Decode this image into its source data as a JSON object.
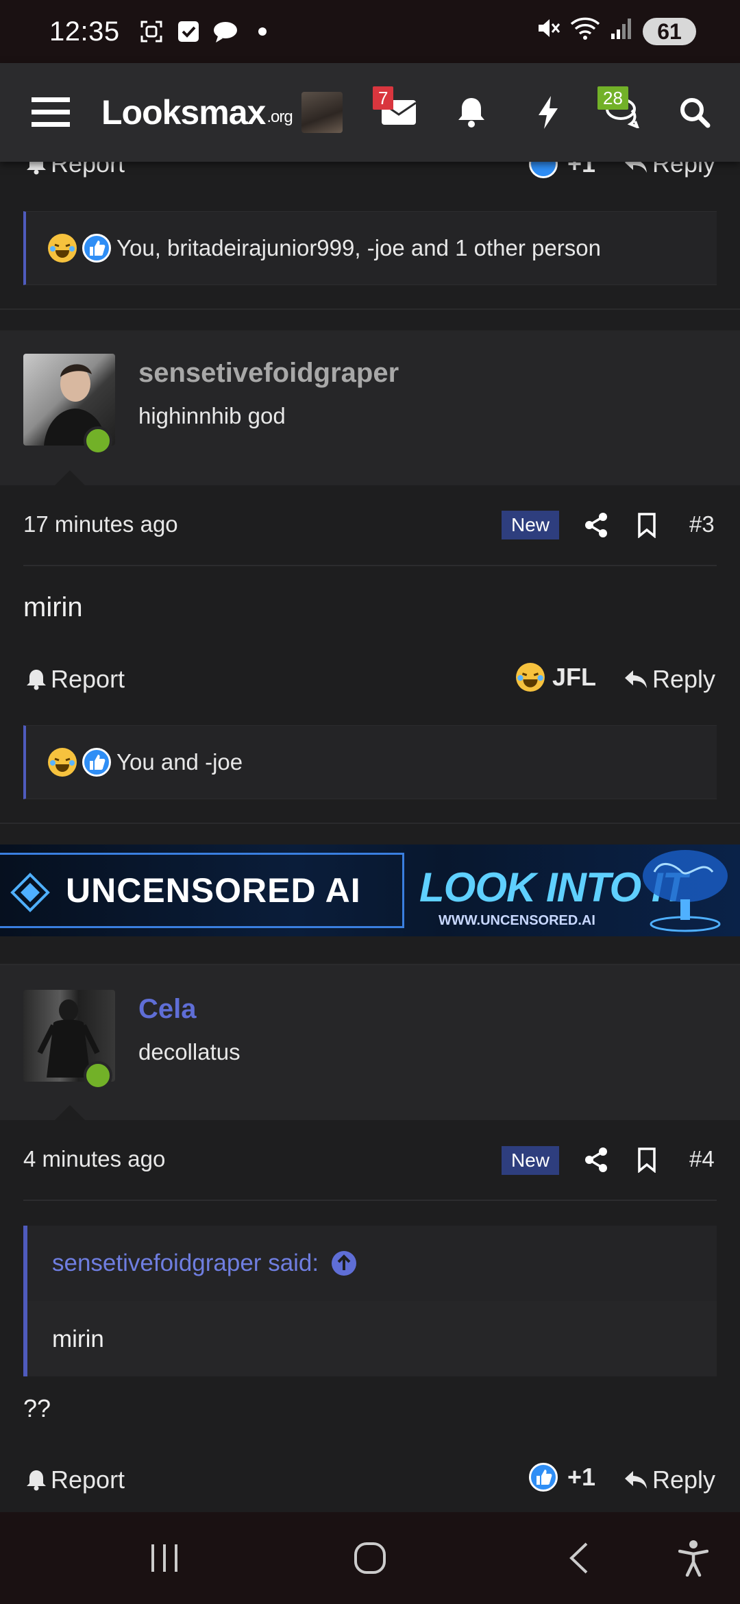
{
  "status_bar": {
    "time": "12:35",
    "battery": "61"
  },
  "nav": {
    "logo_main": "Looksmax",
    "logo_suffix": ".org",
    "inbox_count": "7",
    "conversations_count": "28"
  },
  "prev_post": {
    "report_label": "Report",
    "reaction_count": "+1",
    "reply_label": "Reply",
    "reactions_summary": "You, britadeirajunior999, -joe and 1 other person"
  },
  "post3": {
    "username": "sensetivefoidgraper",
    "user_title": "highinnhib god",
    "time": "17 minutes ago",
    "new_label": "New",
    "post_number": "#3",
    "body": "mirin",
    "report_label": "Report",
    "reaction_label": "JFL",
    "reply_label": "Reply",
    "reactions_summary": "You and -joe"
  },
  "ad": {
    "headline": "UNCENSORED AI",
    "cta": "LOOK INTO IT",
    "url": "WWW.UNCENSORED.AI"
  },
  "post4": {
    "username": "Cela",
    "user_title": "decollatus",
    "time": "4 minutes ago",
    "new_label": "New",
    "post_number": "#4",
    "quote_author": "sensetivefoidgraper said:",
    "quote_text": "mirin",
    "body": "??",
    "report_label": "Report",
    "reaction_count": "+1",
    "reply_label": "Reply"
  },
  "colors": {
    "accent_blue": "#4f5bbd",
    "link_blue": "#6f7ee0",
    "online_green": "#72b128",
    "badge_red": "#d9363e",
    "new_badge": "#2e3e7e"
  }
}
